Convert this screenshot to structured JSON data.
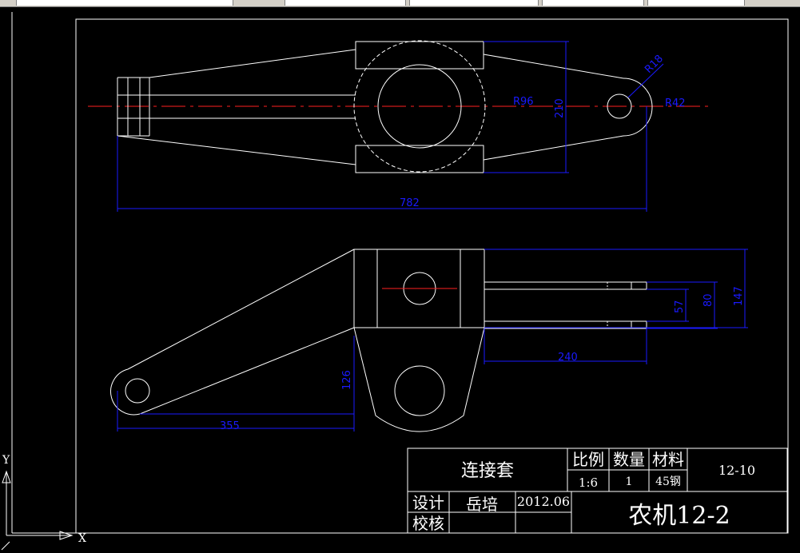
{
  "dimensions": {
    "r18": "R18",
    "r96": "R96",
    "r42": "R42",
    "d210": "210",
    "d782": "782",
    "d147": "147",
    "d80": "80",
    "d57": "57",
    "d240": "240",
    "d126": "126",
    "d355": "355"
  },
  "title_block": {
    "part_name": "连接套",
    "scale_label": "比例",
    "quantity_label": "数量",
    "material_label": "材料",
    "drawing_no": "12-10",
    "scale_value": "1:6",
    "quantity_value": "1",
    "material_value": "45钢",
    "designer_label": "设计",
    "designer_name": "岳培",
    "date": "2012.06",
    "checker_label": "校核",
    "project": "农机12-2"
  },
  "ucs": {
    "x_label": "X",
    "y_label": "Y"
  },
  "colors": {
    "background": "#000000",
    "geometry": "#ffffff",
    "dimension": "#1a1aff",
    "centerline": "#ff2020"
  }
}
